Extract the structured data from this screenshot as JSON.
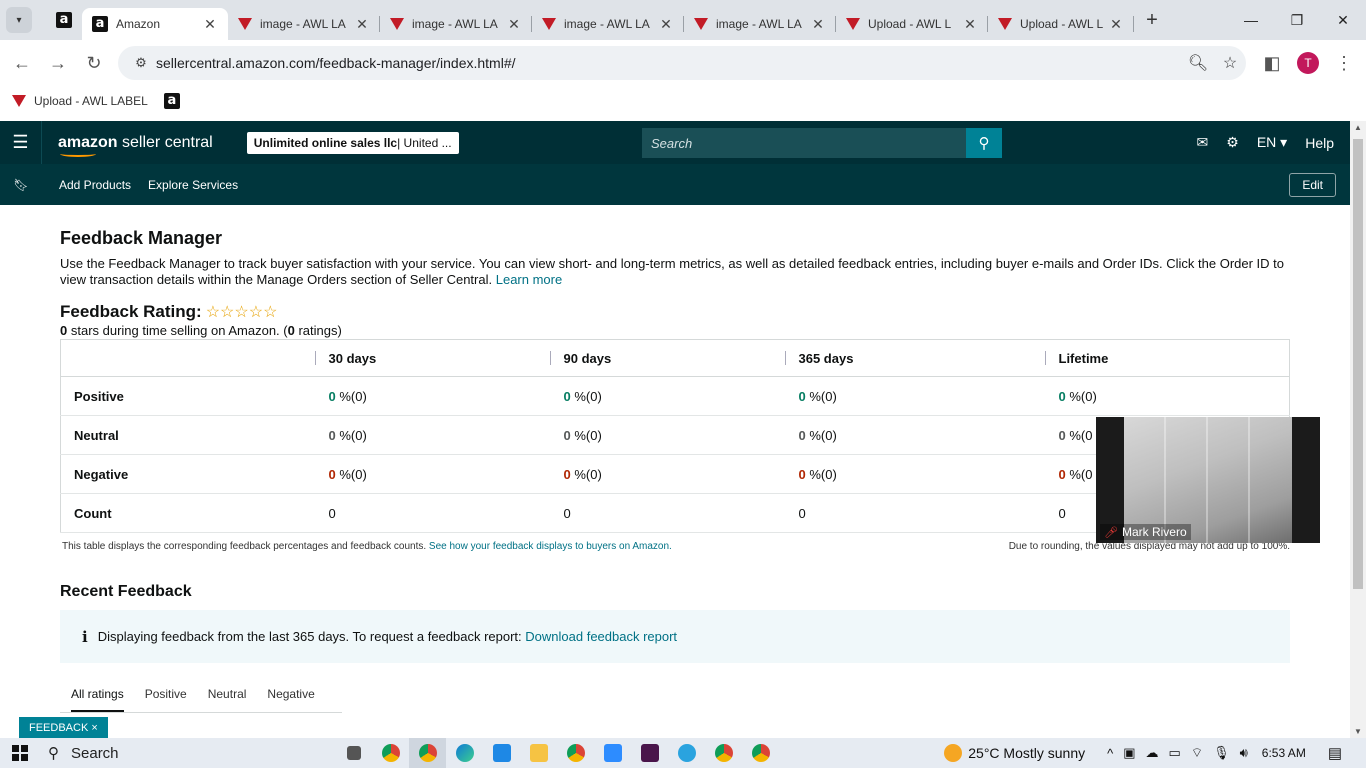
{
  "browser": {
    "tabs": [
      {
        "title": "Amazon",
        "active": true,
        "icon": "amazon-icon"
      },
      {
        "title": "image - AWL LA",
        "icon": "awl-triangle-icon"
      },
      {
        "title": "image - AWL LA",
        "icon": "awl-triangle-icon"
      },
      {
        "title": "image - AWL LA",
        "icon": "awl-triangle-icon"
      },
      {
        "title": "image - AWL LA",
        "icon": "awl-triangle-icon"
      },
      {
        "title": "Upload - AWL L",
        "icon": "awl-triangle-icon"
      },
      {
        "title": "Upload - AWL L",
        "icon": "awl-triangle-icon"
      }
    ],
    "url": "sellercentral.amazon.com/feedback-manager/index.html#/",
    "profile_initial": "T",
    "bookmarks": [
      {
        "label": "Upload - AWL LABEL",
        "icon": "awl-triangle-icon"
      },
      {
        "label": "",
        "icon": "amazon-icon"
      }
    ]
  },
  "header": {
    "logo_bold": "amazon",
    "logo_rest": " seller central",
    "store_bold": "Unlimited online sales llc",
    "store_rest": " | United ...",
    "search_placeholder": "Search",
    "lang": "EN",
    "help": "Help"
  },
  "subnav": {
    "links": [
      "Add Products",
      "Explore Services"
    ],
    "edit": "Edit"
  },
  "page": {
    "title": "Feedback Manager",
    "description": "Use the Feedback Manager to track buyer satisfaction with your service. You can view short- and long-term metrics, as well as detailed feedback entries, including buyer e-mails and Order IDs. Click the Order ID to view transaction details within the Manage Orders section of Seller Central.",
    "learn_more": "Learn more",
    "rating_label": "Feedback Rating:",
    "stars": "☆☆☆☆☆",
    "stars_value": "0",
    "stars_text": " stars during time selling on Amazon. (",
    "ratings_count": "0",
    "ratings_text": " ratings)"
  },
  "feedback_table": {
    "columns": [
      "30 days",
      "90 days",
      "365 days",
      "Lifetime"
    ],
    "rows": [
      {
        "label": "Positive",
        "values": [
          "0",
          "0",
          "0",
          "0"
        ],
        "counts": [
          "%(0)",
          "%(0)",
          "%(0)",
          "%(0)"
        ]
      },
      {
        "label": "Neutral",
        "values": [
          "0",
          "0",
          "0",
          "0"
        ],
        "counts": [
          "%(0)",
          "%(0)",
          "%(0)",
          "%(0"
        ]
      },
      {
        "label": "Negative",
        "values": [
          "0",
          "0",
          "0",
          "0"
        ],
        "counts": [
          "%(0)",
          "%(0)",
          "%(0)",
          "%(0"
        ]
      },
      {
        "label": "Count",
        "values": [
          "0",
          "0",
          "0",
          "0"
        ]
      }
    ],
    "note": "This table displays the corresponding feedback percentages and feedback counts.",
    "note_link": "See how your feedback displays to buyers on Amazon.",
    "rounding_note": "Due to rounding, the values displayed may not add up to 100%."
  },
  "recent": {
    "title": "Recent Feedback",
    "info": "Displaying feedback from the last 365 days. To request a feedback report:",
    "info_link": "Download feedback report",
    "tabs": [
      "All ratings",
      "Positive",
      "Neutral",
      "Negative"
    ]
  },
  "feedback_button": "FEEDBACK ×",
  "video": {
    "participant": "Mark Rivero"
  },
  "taskbar": {
    "search": "Search",
    "weather": "25°C  Mostly sunny",
    "time": "6:53 AM"
  },
  "colors": {
    "header_bg": "#002f36",
    "subnav_bg": "#00363d",
    "link": "#007185",
    "positive": "#067d62",
    "negative": "#b12704"
  }
}
